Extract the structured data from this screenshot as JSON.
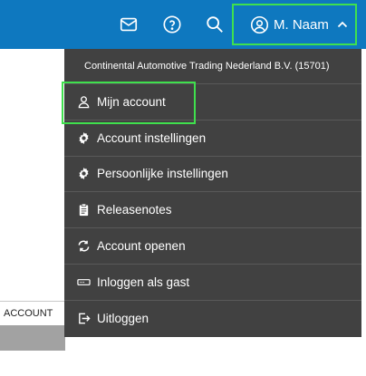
{
  "header": {
    "user_name": "M. Naam",
    "icons": [
      "envelope-icon",
      "help-icon",
      "search-icon",
      "user-circle-icon",
      "chevron-up-icon"
    ]
  },
  "left": {
    "account_tab": "ACCOUNT"
  },
  "dropdown": {
    "company": "Continental Automotive Trading Nederland B.V. (15701)",
    "items": [
      {
        "label": "Mijn account",
        "icon": "user-icon"
      },
      {
        "label": "Account instellingen",
        "icon": "gear-icon"
      },
      {
        "label": "Persoonlijke instellingen",
        "icon": "gear-icon"
      },
      {
        "label": "Releasenotes",
        "icon": "clipboard-icon"
      },
      {
        "label": "Account openen",
        "icon": "swap-icon"
      },
      {
        "label": "Inloggen als gast",
        "icon": "card-icon"
      },
      {
        "label": "Uitloggen",
        "icon": "logout-icon"
      }
    ]
  },
  "colors": {
    "topbar": "#0e78bf",
    "dropdown_bg": "#414141",
    "highlight": "#3fe04d"
  }
}
